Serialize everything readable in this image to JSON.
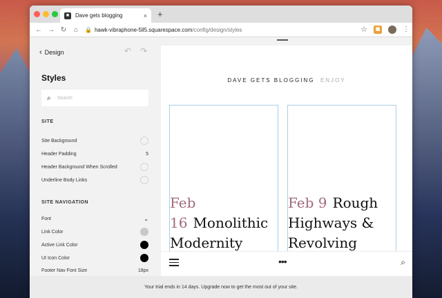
{
  "browser": {
    "tab_title": "Dave gets blogging",
    "tab_close": "×",
    "new_tab": "+",
    "url_host": "hawk-vibraphone-5ll5.squarespace.com",
    "url_path": "/config/design/styles"
  },
  "sidebar": {
    "back_label": "Design",
    "title": "Styles",
    "search_placeholder": "Search",
    "sections": {
      "site": {
        "heading": "SITE",
        "rows": [
          {
            "label": "Site Background"
          },
          {
            "label": "Header Padding",
            "value": "5"
          },
          {
            "label": "Header Background When Scrolled"
          },
          {
            "label": "Underline Body Links"
          }
        ]
      },
      "site_navigation": {
        "heading": "SITE NAVIGATION",
        "rows": [
          {
            "label": "Font"
          },
          {
            "label": "Link Color",
            "color": "#c8c8c8"
          },
          {
            "label": "Active Link Color",
            "color": "#000000"
          },
          {
            "label": "UI Icon Color",
            "color": "#000000"
          },
          {
            "label": "Footer Nav Font Size",
            "value": "18px"
          }
        ]
      }
    }
  },
  "preview": {
    "site_title": "DAVE GETS BLOGGING",
    "site_subtitle": "ENJOY",
    "posts": [
      {
        "date": "Feb 16",
        "title": "Monolithic Modernity"
      },
      {
        "date": "Feb 9",
        "title": "Rough Highways & Revolving"
      }
    ],
    "accent_color": "#a06a7a"
  },
  "trial_message": "Your trial ends in 14 days. Upgrade now to get the most out of your site."
}
